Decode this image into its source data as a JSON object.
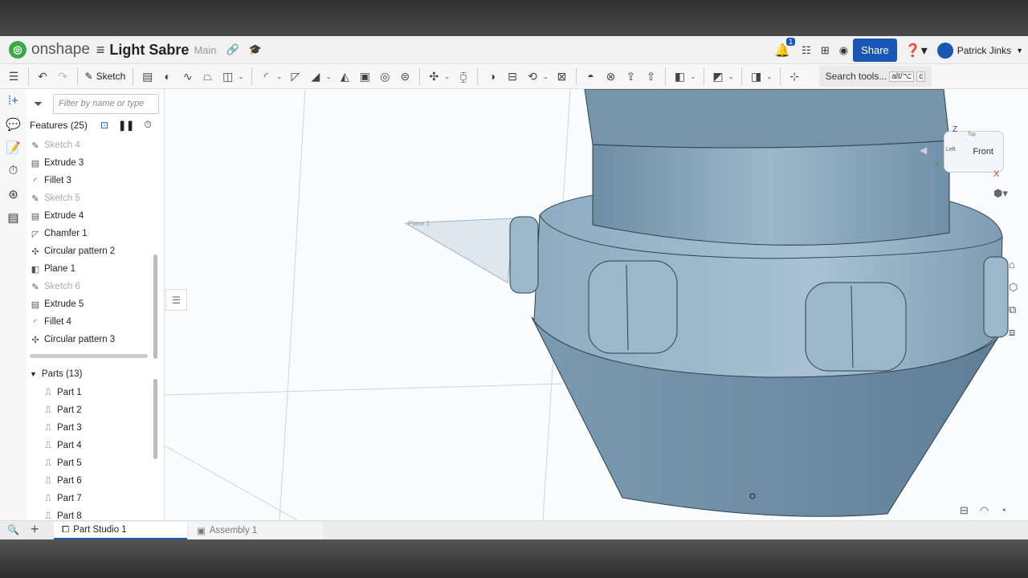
{
  "header": {
    "brand": "onshape",
    "title": "Light Sabre",
    "branch": "Main",
    "notifications": "1",
    "share": "Share",
    "user": "Patrick Jinks"
  },
  "toolbar": {
    "sketch": "Sketch",
    "search": "Search tools...",
    "kbd1": "alt/⌥",
    "kbd2": "c",
    "icons": [
      "extrude-icon",
      "revolve-icon",
      "sweep-icon",
      "loft-icon",
      "thicken-icon",
      "|",
      "fillet-icon",
      "chamfer-icon",
      "draft-icon",
      "rib-icon",
      "shell-icon",
      "hole-icon",
      "thread-icon",
      "|",
      "pattern-icon",
      "mirror-icon",
      "|",
      "boolean-icon",
      "split-icon",
      "transform-icon",
      "delete-part-icon",
      "|",
      "modify-fillet-icon",
      "delete-face-icon",
      "move-face-icon",
      "replace-face-icon",
      "|",
      "plane-icon",
      "|",
      "mate-connector-icon",
      "|",
      "section-view-icon",
      "|",
      "fit-icon"
    ]
  },
  "panel": {
    "filter_placeholder": "Filter by name or type",
    "features_title": "Features (25)",
    "features": [
      {
        "label": "Sketch 4",
        "type": "sketch"
      },
      {
        "label": "Extrude 3",
        "type": "extrude"
      },
      {
        "label": "Fillet 3",
        "type": "fillet"
      },
      {
        "label": "Sketch 5",
        "type": "sketch"
      },
      {
        "label": "Extrude 4",
        "type": "extrude"
      },
      {
        "label": "Chamfer 1",
        "type": "chamfer"
      },
      {
        "label": "Circular pattern 2",
        "type": "pattern"
      },
      {
        "label": "Plane 1",
        "type": "plane"
      },
      {
        "label": "Sketch 6",
        "type": "sketch"
      },
      {
        "label": "Extrude 5",
        "type": "extrude"
      },
      {
        "label": "Fillet 4",
        "type": "fillet"
      },
      {
        "label": "Circular pattern 3",
        "type": "pattern"
      }
    ],
    "parts_title": "Parts (13)",
    "parts": [
      "Part 1",
      "Part 2",
      "Part 3",
      "Part 4",
      "Part 5",
      "Part 6",
      "Part 7",
      "Part 8"
    ]
  },
  "viewport": {
    "plane_label": "Plane 1",
    "cube_front": "Front",
    "cube_left": "Left",
    "axis_x": "X",
    "axis_y": "Y",
    "axis_z": "Z",
    "cube_top": "Top"
  },
  "tabs": [
    {
      "label": "Part Studio 1",
      "active": true
    },
    {
      "label": "Assembly 1",
      "active": false
    }
  ],
  "colors": {
    "accent": "#1a57b5",
    "part": "#7f9fb5",
    "brand": "#3aa845"
  }
}
